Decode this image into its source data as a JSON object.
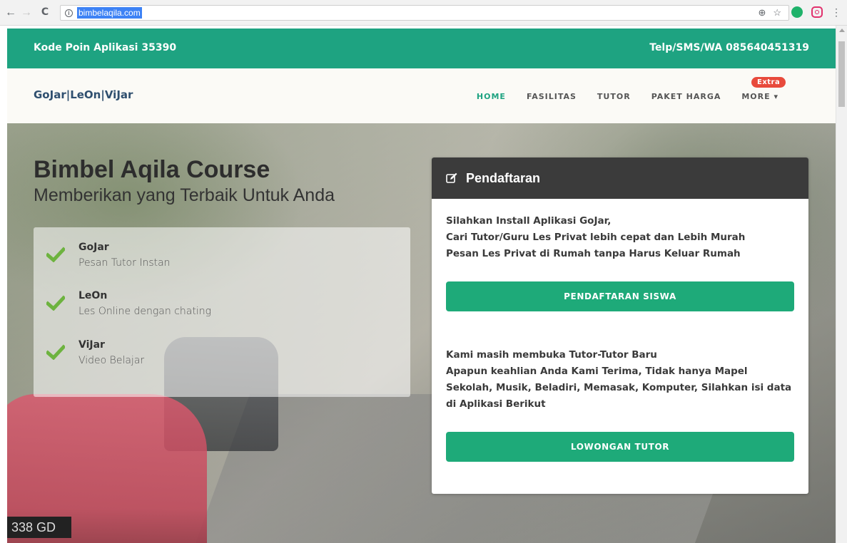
{
  "browser": {
    "url": "bimbelaqila.com",
    "back_icon": "arrow-left-icon",
    "forward_icon": "arrow-right-icon",
    "reload_icon": "reload-icon",
    "back_glyph": "←",
    "forward_glyph": "→",
    "reload_glyph": "C",
    "info_glyph": "i",
    "zoom_glyph": "⊕",
    "star_glyph": "☆",
    "menu_glyph": "⋮"
  },
  "topbar": {
    "left_text": "Kode Poin Aplikasi 35390",
    "right_text": "Telp/SMS/WA 085640451319",
    "color": "#1ea381"
  },
  "navbar": {
    "brand": "GoJar|LeOn|ViJar",
    "items": [
      {
        "label": "HOME",
        "active": true
      },
      {
        "label": "FASILITAS",
        "active": false
      },
      {
        "label": "TUTOR",
        "active": false
      },
      {
        "label": "PAKET HARGA",
        "active": false
      },
      {
        "label": "MORE ▾",
        "active": false
      }
    ],
    "badge": "Extra"
  },
  "hero": {
    "title": "Bimbel Aqila Course",
    "subtitle": "Memberikan yang Terbaik Untuk Anda",
    "plate_text": "338 GD",
    "features": [
      {
        "name": "GoJar",
        "desc": "Pesan Tutor Instan"
      },
      {
        "name": "LeOn",
        "desc": "Les Online dengan chating"
      },
      {
        "name": "ViJar",
        "desc": "Video Belajar"
      }
    ]
  },
  "panel": {
    "title": "Pendaftaran",
    "text1": "Silahkan Install Aplikasi GoJar,\nCari Tutor/Guru Les Privat lebih cepat dan Lebih Murah\nPesan Les Privat di Rumah tanpa Harus Keluar Rumah",
    "button1": "PENDAFTARAN SISWA",
    "text2": "Kami masih membuka Tutor-Tutor Baru\nApapun keahlian Anda Kami Terima, Tidak hanya Mapel Sekolah, Musik, Beladiri, Memasak, Komputer, Silahkan isi data di Aplikasi Berikut",
    "button2": "LOWONGAN TUTOR",
    "button_color": "#1eaa79"
  }
}
